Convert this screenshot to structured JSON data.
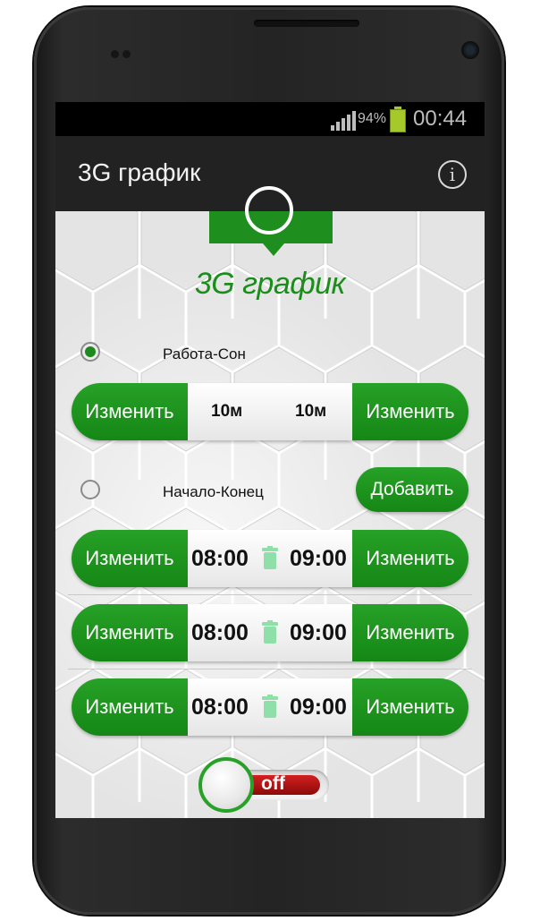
{
  "status_bar": {
    "battery_percent": "94%",
    "time": "00:44",
    "battery_color": "#a5c82a"
  },
  "action_bar": {
    "title": "3G график",
    "info_icon": "info-icon"
  },
  "logo": {
    "title": "3G график",
    "icon": "clock-icon",
    "accent": "#1e8e1e"
  },
  "mode_work_sleep": {
    "label": "Работа-Сон",
    "selected": true,
    "change_left": "Изменить",
    "value_left": "10м",
    "value_right": "10м",
    "change_right": "Изменить"
  },
  "mode_start_end": {
    "label": "Начало-Конец",
    "selected": false,
    "add_button": "Добавить"
  },
  "schedules": [
    {
      "change_left": "Изменить",
      "start": "08:00",
      "end": "09:00",
      "change_right": "Изменить"
    },
    {
      "change_left": "Изменить",
      "start": "08:00",
      "end": "09:00",
      "change_right": "Изменить"
    },
    {
      "change_left": "Изменить",
      "start": "08:00",
      "end": "09:00",
      "change_right": "Изменить"
    }
  ],
  "toggle": {
    "label": "off",
    "state": "off",
    "color_off": "#c01414"
  }
}
